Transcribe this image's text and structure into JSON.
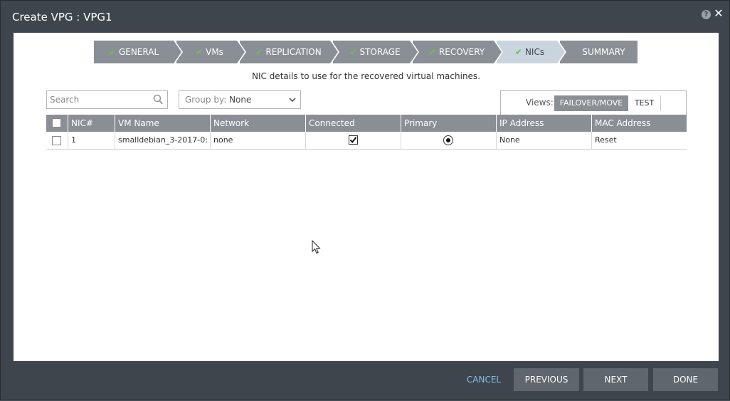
{
  "window": {
    "title": "Create VPG : VPG1",
    "help_glyph": "?",
    "close_glyph": "✕"
  },
  "wizard": {
    "steps": [
      {
        "label": "GENERAL",
        "done": true,
        "active": false
      },
      {
        "label": "VMs",
        "done": true,
        "active": false
      },
      {
        "label": "REPLICATION",
        "done": true,
        "active": false
      },
      {
        "label": "STORAGE",
        "done": true,
        "active": false
      },
      {
        "label": "RECOVERY",
        "done": true,
        "active": false
      },
      {
        "label": "NICs",
        "done": true,
        "active": true
      },
      {
        "label": "SUMMARY",
        "done": false,
        "active": false
      }
    ],
    "check_glyph": "✔"
  },
  "subtitle": "NIC details to use for the recovered virtual machines.",
  "search": {
    "placeholder": "Search",
    "value": ""
  },
  "groupby": {
    "label": "Group by:",
    "value": "None"
  },
  "views": {
    "label": "Views:",
    "options": [
      "FAILOVER/MOVE",
      "TEST"
    ],
    "selected": "FAILOVER/MOVE"
  },
  "table": {
    "columns": [
      "NIC#",
      "VM Name",
      "Network",
      "Connected",
      "Primary",
      "IP Address",
      "MAC Address"
    ],
    "rows": [
      {
        "nic": "1",
        "vm_name": "smalldebian_3-2017-0:",
        "network": "none",
        "connected": true,
        "primary": true,
        "ip_address": "None",
        "mac_address": "Reset"
      }
    ]
  },
  "footer": {
    "cancel": "CANCEL",
    "previous": "PREVIOUS",
    "next": "NEXT",
    "done": "DONE"
  },
  "colors": {
    "dialog_bg": "#3f454d",
    "step_bg": "#8a8f95",
    "step_active_bg": "#c9d4de",
    "check": "#6cc04a",
    "cancel_link": "#7fc0e8",
    "button_bg": "#60666e"
  }
}
